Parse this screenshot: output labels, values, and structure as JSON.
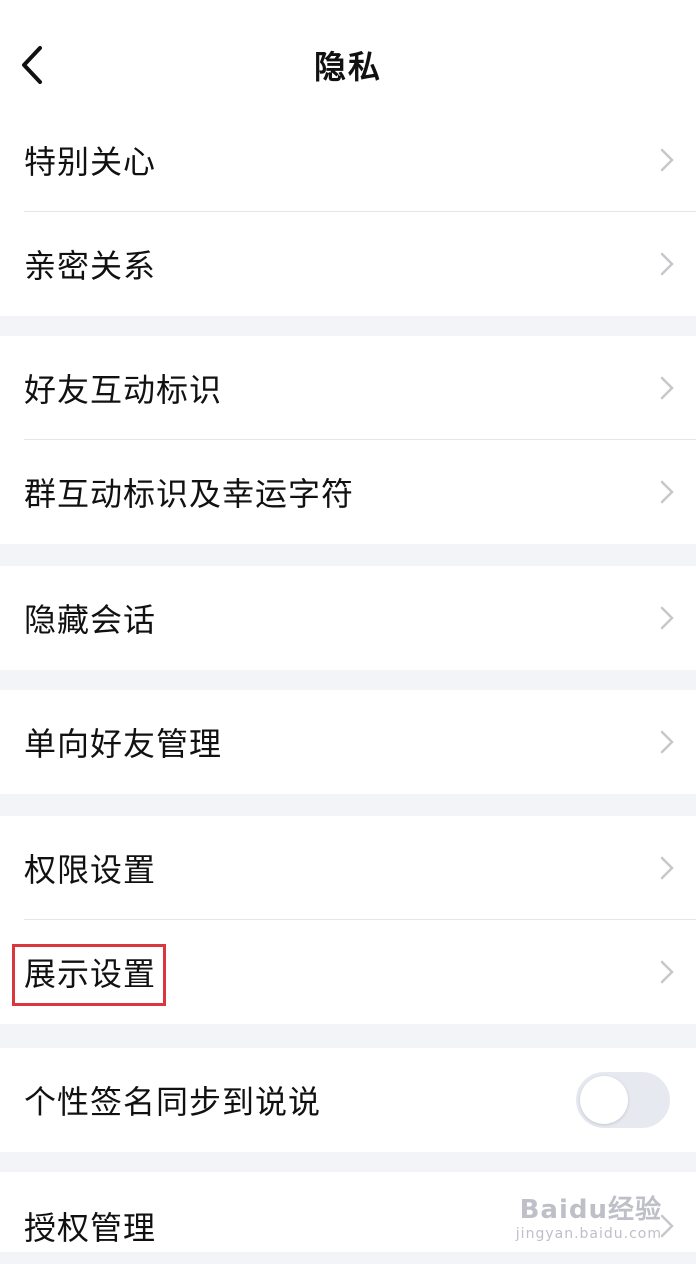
{
  "header": {
    "title": "隐私",
    "back_icon": "chevron-left-icon"
  },
  "groups": [
    {
      "items": [
        {
          "label": "特别关心"
        },
        {
          "label": "亲密关系"
        }
      ]
    },
    {
      "items": [
        {
          "label": "好友互动标识"
        },
        {
          "label": "群互动标识及幸运字符"
        }
      ]
    },
    {
      "items": [
        {
          "label": "隐藏会话"
        }
      ]
    },
    {
      "items": [
        {
          "label": "单向好友管理"
        }
      ]
    },
    {
      "items": [
        {
          "label": "权限设置"
        },
        {
          "label": "展示设置",
          "highlighted": true
        }
      ]
    },
    {
      "items": [
        {
          "label": "个性签名同步到说说",
          "toggle": false
        }
      ]
    },
    {
      "items": [
        {
          "label": "授权管理"
        }
      ]
    }
  ],
  "watermark": {
    "main": "Baidu经验",
    "sub": "jingyan.baidu.com"
  },
  "colors": {
    "highlight": "#d9363e",
    "chevron": "#c7c7cc",
    "toggle_off": "#e6e9f0"
  }
}
